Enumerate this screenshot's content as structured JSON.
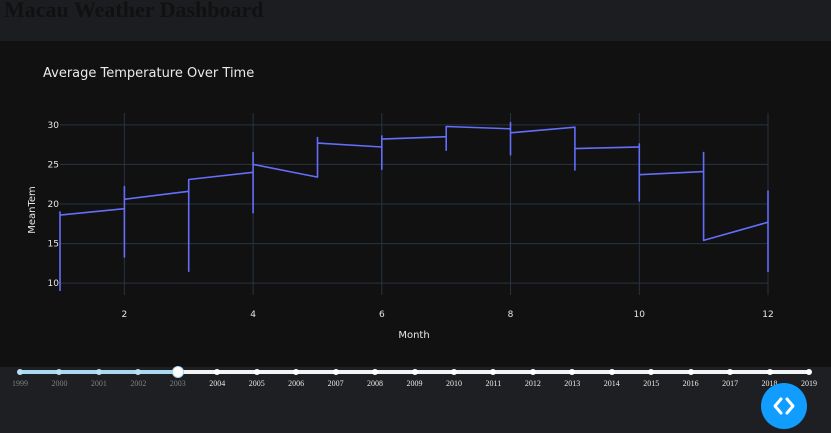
{
  "page": {
    "title": "Macau Weather Dashboard"
  },
  "colors": {
    "line": "#636efa",
    "plot_bg": "#111111",
    "grid": "#283442",
    "slider_accent": "#a9d8f0",
    "debug_button": "#119dff"
  },
  "icons": {
    "debug": "code-brackets-icon"
  },
  "chart_data": {
    "type": "line",
    "title": "Average Temperature Over Time",
    "xlabel": "Month",
    "ylabel": "MeanTem",
    "xlim": [
      1,
      12
    ],
    "ylim": [
      8.5,
      31.5
    ],
    "xticks": [
      2,
      4,
      6,
      8,
      10,
      12
    ],
    "yticks": [
      10,
      15,
      20,
      25,
      30
    ],
    "grid": true,
    "series": [
      {
        "x": [
          1,
          1,
          1,
          2,
          2,
          2,
          2,
          3,
          3,
          3,
          4,
          4,
          4,
          4,
          5,
          5,
          5,
          6,
          6,
          6,
          6,
          7,
          7,
          7,
          8,
          8,
          8,
          8,
          9,
          9,
          9,
          10,
          10,
          10,
          10,
          11,
          11,
          11,
          12,
          12,
          12
        ],
        "y": [
          9.0,
          19.0,
          18.6,
          19.4,
          13.3,
          22.2,
          20.6,
          21.6,
          11.5,
          23.1,
          24.0,
          18.9,
          26.5,
          25.0,
          23.4,
          28.4,
          27.7,
          27.2,
          24.4,
          28.6,
          28.2,
          28.5,
          26.8,
          29.8,
          29.5,
          26.2,
          30.3,
          29.0,
          29.7,
          24.3,
          27.0,
          27.2,
          20.4,
          27.6,
          23.7,
          24.1,
          26.5,
          15.4,
          17.7,
          11.5,
          21.7
        ]
      }
    ]
  },
  "slider": {
    "marks": [
      "1999",
      "2000",
      "2001",
      "2002",
      "2003",
      "2004",
      "2005",
      "2006",
      "2007",
      "2008",
      "2009",
      "2010",
      "2011",
      "2012",
      "2013",
      "2014",
      "2015",
      "2016",
      "2017",
      "2018",
      "2019"
    ],
    "selected": "2003"
  }
}
